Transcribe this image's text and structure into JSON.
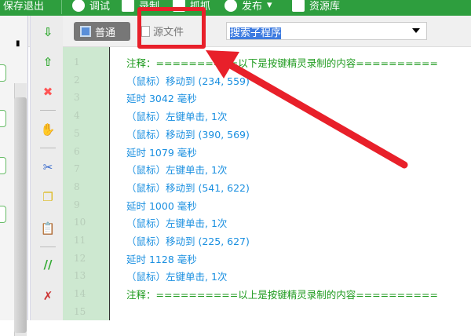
{
  "menu": [
    "保存退出",
    "调试",
    "录制",
    "抓抓",
    "发布",
    "资源库"
  ],
  "toolbar": {
    "normal": "普通",
    "source": "源文件",
    "search": "搜索子程序"
  },
  "line_numbers": [
    "1",
    "2",
    "3",
    "4",
    "5",
    "6",
    "7",
    "8",
    "9",
    "10",
    "11",
    "12",
    "13",
    "14",
    "15"
  ],
  "code": [
    "注释：==========以下是按键精灵录制的内容==========",
    "（鼠标）移动到 (234, 559)",
    "延时 3042 毫秒",
    "（鼠标）左键单击, 1次",
    "（鼠标）移动到 (390, 569)",
    "延时 1079 毫秒",
    "（鼠标）左键单击, 1次",
    "（鼠标）移动到 (541, 622)",
    "延时 1000 毫秒",
    "（鼠标）左键单击, 1次",
    "（鼠标）移动到 (225, 627)",
    "延时 1128 毫秒",
    "（鼠标）左键单击, 1次",
    "注释：==========以上是按键精灵录制的内容=========="
  ],
  "colors": {
    "accent": "#2e9e3e",
    "highlight": "#e8202a"
  }
}
